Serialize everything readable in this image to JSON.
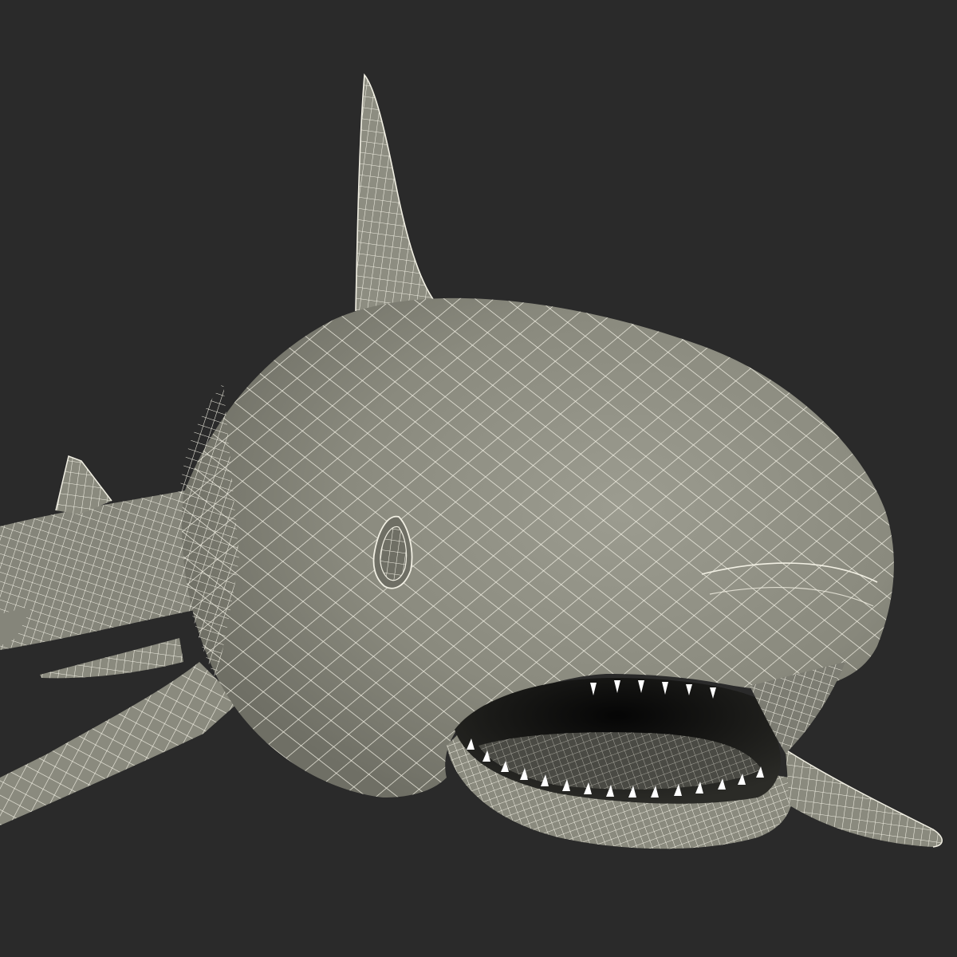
{
  "scene": {
    "subject": "shark-wireframe-model",
    "colors": {
      "background": "#2a2a2a",
      "surface": "#8a8a7e",
      "surface_light": "#9c9c90",
      "surface_dark": "#6f6f65",
      "wire": "#f2f0e4",
      "mouth_interior": "#141414",
      "teeth": "#ffffff"
    }
  }
}
